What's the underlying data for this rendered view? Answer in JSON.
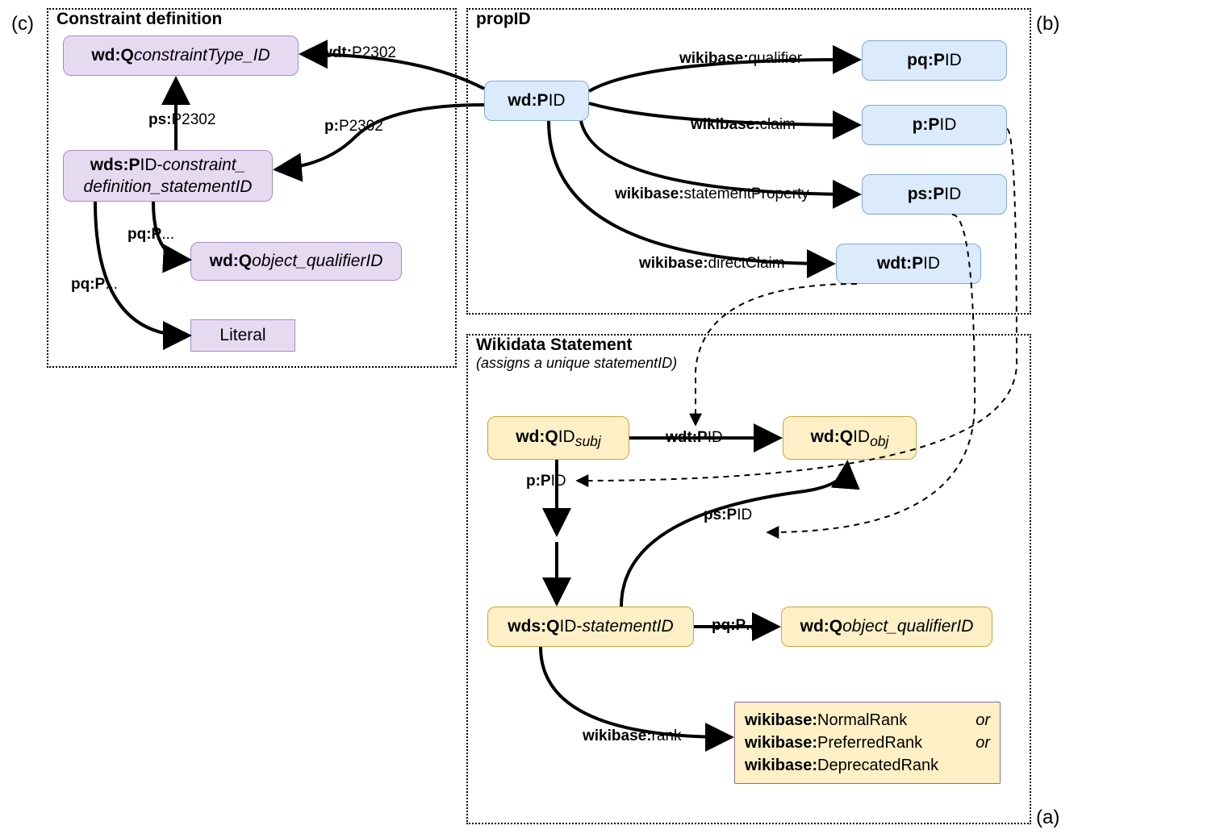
{
  "sideLabels": {
    "a": "(a)",
    "b": "(b)",
    "c": "(c)"
  },
  "panels": {
    "constraint": {
      "title": "Constraint definition"
    },
    "propid": {
      "title": "propID"
    },
    "statement": {
      "title": "Wikidata Statement",
      "subtitle": "(assigns a unique statementID)"
    }
  },
  "nodes": {
    "wdQconstraint": {
      "pre": "wd:Q",
      "ital": "constraintType_ID"
    },
    "wdsPID": {
      "line1pre": "wds:P",
      "line1plain": "ID-",
      "line1ital": "constraint_",
      "line2ital": "definition_statementID"
    },
    "wdQobjqual": {
      "pre": "wd:Q",
      "ital": "object_qualifierID"
    },
    "literal": "Literal",
    "wdPID": {
      "pre": "wd:P",
      "plain": "ID"
    },
    "pqPID": {
      "pre": "pq:P",
      "plain": "ID"
    },
    "pPID": {
      "pre": "p:P",
      "plain": "ID"
    },
    "psPID": {
      "pre": "ps:P",
      "plain": "ID"
    },
    "wdtPID": {
      "pre": "wdt:P",
      "plain": "ID"
    },
    "wdQsubj": {
      "pre": "wd:Q",
      "plain": "ID",
      "sub": "subj"
    },
    "wdQobj": {
      "pre": "wd:Q",
      "plain": "ID",
      "sub": "obj"
    },
    "wdsQID": {
      "pre": "wds:Q",
      "plain": "ID-",
      "ital": "statementID"
    },
    "wdQobjqual2": {
      "pre": "wd:Q",
      "ital": "object_qualifierID"
    },
    "ranks": {
      "normal": {
        "pre": "wikibase:",
        "plain": "NormalRank"
      },
      "preferred": {
        "pre": "wikibase:",
        "plain": "PreferredRank"
      },
      "deprecated": {
        "pre": "wikibase:",
        "plain": "DeprecatedRank"
      },
      "or": "or"
    }
  },
  "edges": {
    "wdtP2302": {
      "pre": "wdt:",
      "plain": "P2302"
    },
    "psP2302": {
      "pre": "ps:",
      "plain": "P2302"
    },
    "pP2302": {
      "pre": "p:",
      "plain": "P2302"
    },
    "pqP1": {
      "pre": "pq:P",
      "plain": "..."
    },
    "pqP2": {
      "pre": "pq:P",
      "plain": "..."
    },
    "wbQualifier": {
      "pre": "wikibase:",
      "plain": "qualifier"
    },
    "wbClaim": {
      "pre": "wikibase:",
      "plain": "claim"
    },
    "wbStmtProp": {
      "pre": "wikibase:",
      "plain": "statementProperty"
    },
    "wbDirectClaim": {
      "pre": "wikibase:",
      "plain": "directClaim"
    },
    "wdtPIDstmt": {
      "pre": "wdt:P",
      "plain": "ID"
    },
    "pPIDstmt": {
      "pre": "p:P",
      "plain": "ID"
    },
    "psPIDstmt": {
      "pre": "ps:P",
      "plain": "ID"
    },
    "pqPstmt": {
      "pre": "pq:P",
      "plain": "..."
    },
    "wbRank": {
      "pre": "wikibase:",
      "plain": "rank"
    }
  }
}
